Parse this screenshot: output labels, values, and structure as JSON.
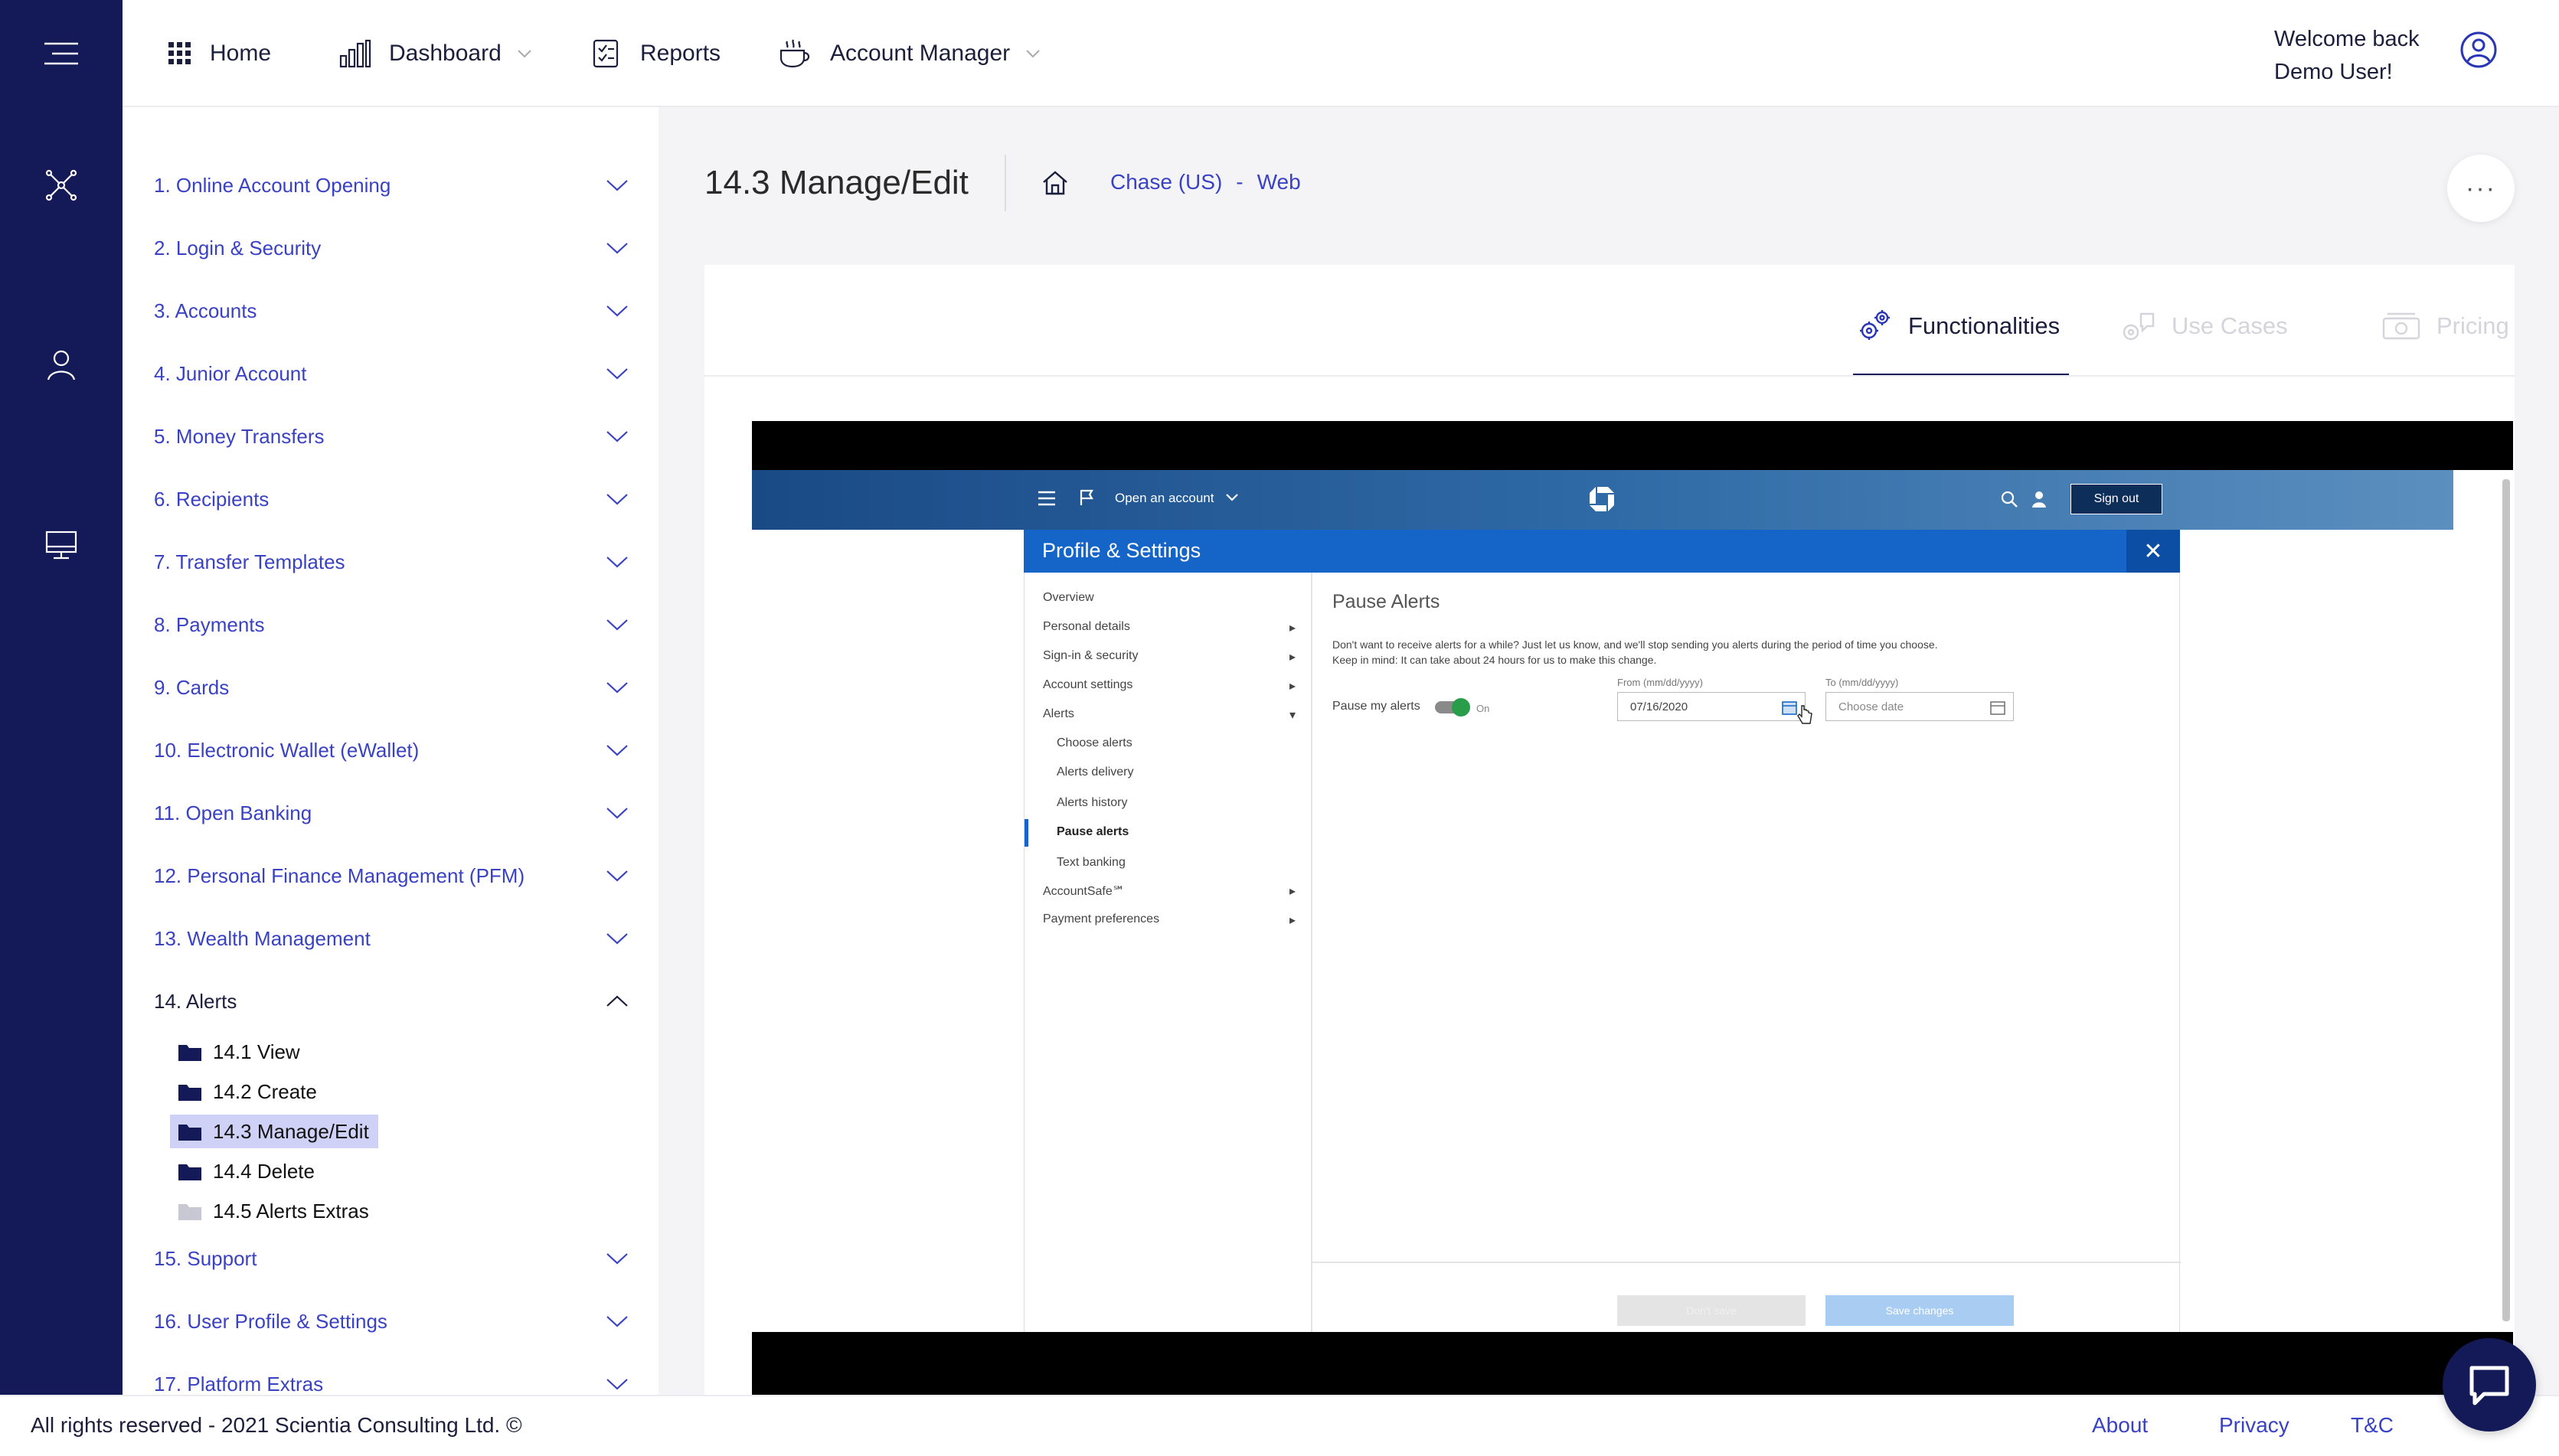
{
  "topnav": {
    "home": "Home",
    "dashboard": "Dashboard",
    "reports": "Reports",
    "account_manager": "Account Manager",
    "welcome_line1": "Welcome back",
    "welcome_line2": "Demo User!"
  },
  "sidebar": {
    "items": [
      "1. Online Account Opening",
      "2. Login & Security",
      "3. Accounts",
      "4. Junior Account",
      "5. Money Transfers",
      "6. Recipients",
      "7. Transfer Templates",
      "8. Payments",
      "9. Cards",
      "10. Electronic Wallet (eWallet)",
      "11. Open Banking",
      "12. Personal Finance Management (PFM)",
      "13. Wealth Management",
      "14. Alerts",
      "15. Support",
      "16. User Profile & Settings",
      "17. Platform Extras"
    ],
    "alerts_sub": [
      "14.1 View",
      "14.2 Create",
      "14.3 Manage/Edit",
      "14.4 Delete",
      "14.5 Alerts Extras"
    ]
  },
  "page": {
    "title": "14.3 Manage/Edit",
    "bank": "Chase (US)",
    "sep": "-",
    "platform": "Web",
    "more": "···"
  },
  "tabs": {
    "functionalities": "Functionalities",
    "use_cases": "Use Cases",
    "pricing": "Pricing"
  },
  "screenshot": {
    "open_account": "Open an account",
    "sign_out": "Sign out",
    "modal_title": "Profile & Settings",
    "menu": [
      "Overview",
      "Personal details",
      "Sign-in & security",
      "Account settings",
      "Alerts",
      "Choose alerts",
      "Alerts delivery",
      "Alerts history",
      "Pause alerts",
      "Text banking",
      "AccountSafe℠",
      "Payment preferences"
    ],
    "heading": "Pause Alerts",
    "desc1": "Don't want to receive alerts for a while? Just let us know, and we'll stop sending you alerts during the period of time you choose.",
    "desc2": "Keep in mind: It can take about 24 hours for us to make this change.",
    "pause_label": "Pause my alerts",
    "toggle_state": "On",
    "from_label": "From (mm/dd/yyyy)",
    "from_value": "07/16/2020",
    "to_label": "To (mm/dd/yyyy)",
    "to_placeholder": "Choose date",
    "cancel": "Don't save",
    "save": "Save changes"
  },
  "footer": {
    "copyright": "All rights reserved - 2021 Scientia Consulting Ltd. ©",
    "about": "About",
    "privacy": "Privacy",
    "tc": "T&C"
  },
  "colors": {
    "rail": "#141a58",
    "link": "#3a42c4",
    "chase_blue": "#1565c9"
  }
}
